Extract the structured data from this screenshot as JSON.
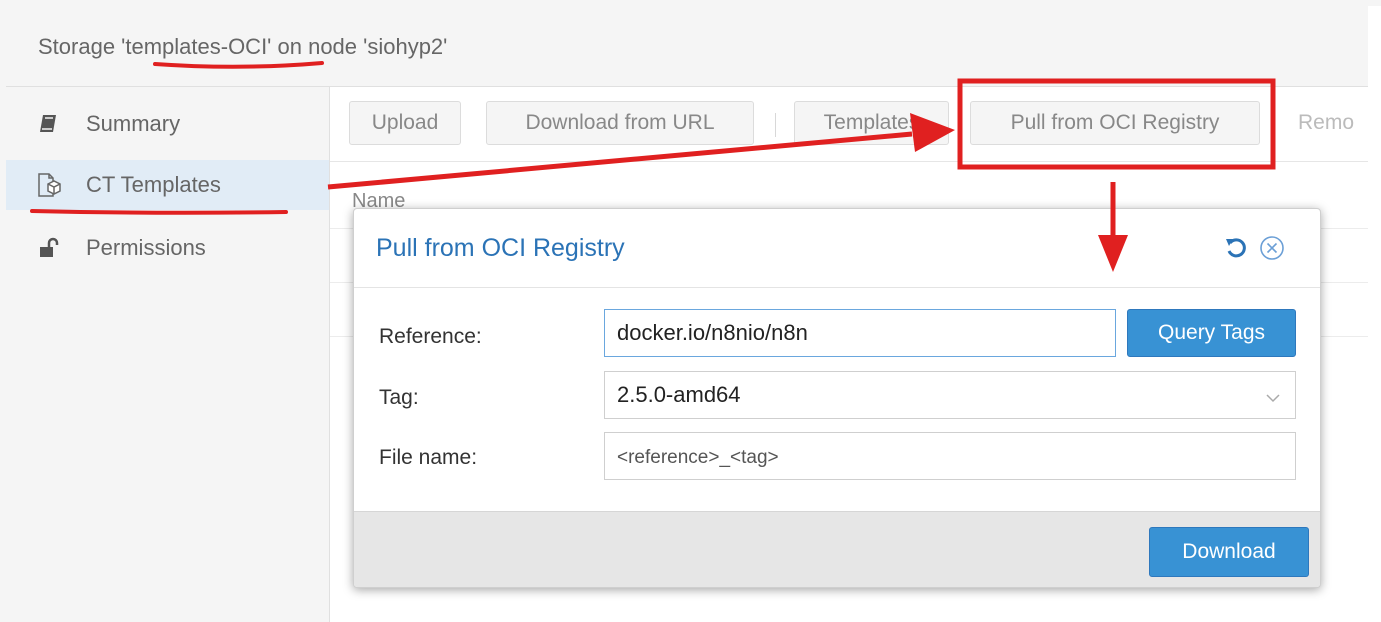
{
  "header": {
    "title": "Storage 'templates-OCI' on node 'siohyp2'"
  },
  "sidebar": {
    "items": [
      {
        "label": "Summary",
        "icon": "book-icon"
      },
      {
        "label": "CT Templates",
        "icon": "file-cube-icon",
        "active": true
      },
      {
        "label": "Permissions",
        "icon": "unlock-icon"
      }
    ]
  },
  "toolbar": {
    "upload_label": "Upload",
    "download_url_label": "Download from URL",
    "templates_label": "Templates",
    "pull_oci_label": "Pull from OCI Registry",
    "remove_label": "Remo"
  },
  "grid": {
    "column_name": "Name"
  },
  "dialog": {
    "title": "Pull from OCI Registry",
    "reference_label": "Reference:",
    "reference_value": "docker.io/n8nio/n8n",
    "query_tags_label": "Query Tags",
    "tag_label": "Tag:",
    "tag_value": "2.5.0-amd64",
    "filename_label": "File name:",
    "filename_placeholder": "<reference>_<tag>",
    "download_label": "Download"
  },
  "colors": {
    "accent": "#2b73b6",
    "primary_button": "#3892d4",
    "annotation": "#e02020",
    "sidebar_active": "#e1ecf6"
  }
}
